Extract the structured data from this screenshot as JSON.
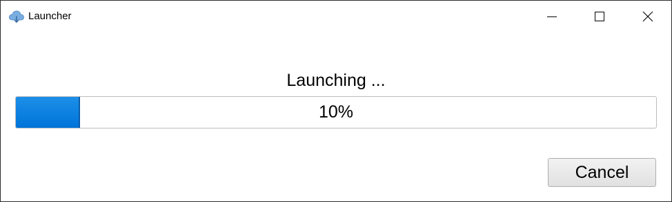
{
  "window": {
    "title": "Launcher",
    "app_icon": "cloud-download-icon",
    "controls": {
      "minimize_icon": "minimize-icon",
      "maximize_icon": "maximize-icon",
      "close_icon": "close-icon"
    }
  },
  "main": {
    "status_text": "Launching ...",
    "progress": {
      "label": "10%",
      "fraction": 0.1,
      "fill_color": "#0078d7"
    },
    "cancel_label": "Cancel"
  }
}
